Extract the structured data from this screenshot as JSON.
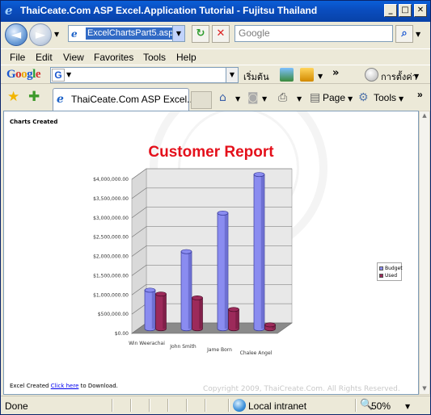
{
  "window": {
    "title": "ThaiCeate.Com ASP Excel.Application Tutorial - Fujitsu Thailand",
    "minimize_icon": "minimize-icon",
    "maximize_icon": "maximize-icon",
    "close_icon": "close-icon"
  },
  "address_bar": {
    "url": "ExcelChartsPart5.asp",
    "search_placeholder": "Google"
  },
  "menu": [
    "File",
    "Edit",
    "View",
    "Favorites",
    "Tools",
    "Help"
  ],
  "google_toolbar": {
    "logo": "Google",
    "start_label": "เริ่มต้น",
    "settings_label": "การตั้งค่า",
    "more": "»"
  },
  "tabs": {
    "active_label": "ThaiCeate.Com ASP Excel...",
    "page_label": "Page",
    "tools_label": "Tools",
    "more": "»"
  },
  "page": {
    "heading": "Charts Created",
    "excel_prefix": "Excel Created ",
    "link_text": "Click here",
    "excel_suffix": " to Download.",
    "copyright": "Copyright 2009, ThaiCreate.Com. All Rights Reserved."
  },
  "chart_data": {
    "type": "bar",
    "title": "Customer Report",
    "categories": [
      "Win Weerachai",
      "John Smith",
      "Jame Born",
      "Chalee Angel"
    ],
    "series": [
      {
        "name": "Budget",
        "values": [
          1000000,
          2000000,
          3000000,
          4000000
        ],
        "color": "#8a8cf0"
      },
      {
        "name": "Used",
        "values": [
          900000,
          800000,
          500000,
          100000
        ],
        "color": "#9c2a5a"
      }
    ],
    "ylim": [
      0,
      4000000
    ],
    "yticks": [
      "$0.00",
      "$500,000.00",
      "$1,000,000.00",
      "$1,500,000.00",
      "$2,000,000.00",
      "$2,500,000.00",
      "$3,000,000.00",
      "$3,500,000.00",
      "$4,000,000.00"
    ],
    "grid": true,
    "legend": "right"
  },
  "status": {
    "text": "Done",
    "zone": "Local intranet",
    "zoom": "50%"
  }
}
